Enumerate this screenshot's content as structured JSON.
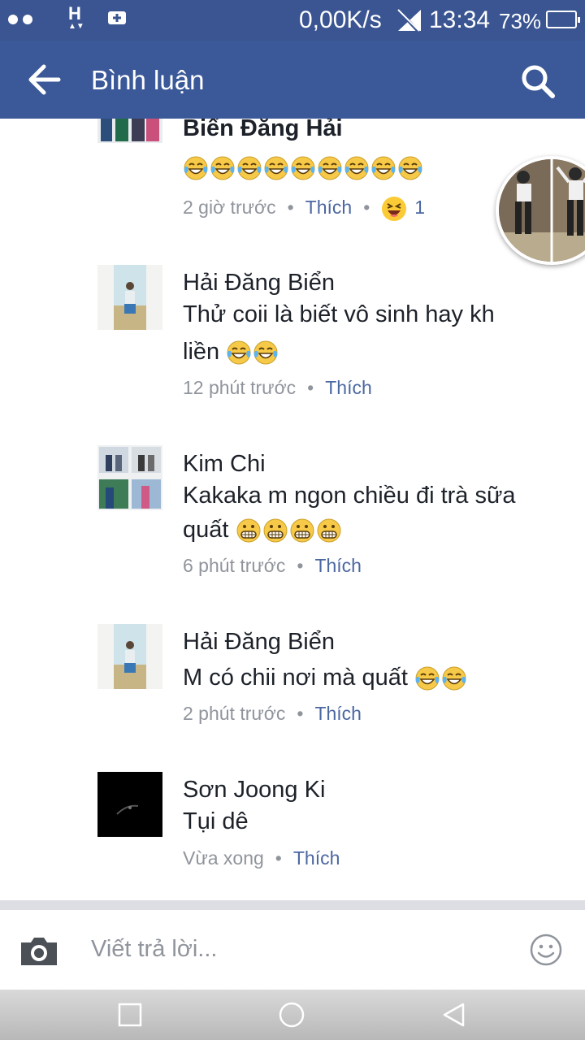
{
  "status_bar": {
    "net_speed": "0,00K/s",
    "time": "13:34",
    "battery": "73%",
    "network_letter": "H"
  },
  "header": {
    "title": "Bình luận",
    "back_icon": "arrow-left-icon",
    "search_icon": "search-icon"
  },
  "comments": [
    {
      "author": "Biển Đăng Hải",
      "emoji_count": 9,
      "emoji": "tears-of-joy",
      "time": "2 giờ trước",
      "like": "Thích",
      "reaction": "laughing",
      "reaction_count": "1"
    },
    {
      "author": "Hải Đăng Biển",
      "text_line1": "Thử coii là biết vô sinh hay kh",
      "text_line2": "liền",
      "emoji": "tears-of-joy",
      "emoji_count": 2,
      "time": "12 phút trước",
      "like": "Thích"
    },
    {
      "author": "Kim Chi",
      "text_line1": "Kakaka m ngon chiều đi trà sữa",
      "text_line2": "quất",
      "emoji": "grinning",
      "emoji_count": 4,
      "time": "6 phút trước",
      "like": "Thích"
    },
    {
      "author": "Hải Đăng Biển",
      "text_line1": "M có chii nơi mà quất",
      "emoji": "tears-of-joy",
      "emoji_count": 2,
      "time": "2 phút trước",
      "like": "Thích"
    },
    {
      "author": "Sơn Joong Ki",
      "text_line1": "Tụi dê",
      "time": "Vừa xong",
      "like": "Thích"
    }
  ],
  "composer": {
    "placeholder": "Viết trả lời...",
    "camera_icon": "camera-icon",
    "emoji_icon": "smiley-icon"
  },
  "nav_bar": {
    "buttons": [
      "recent-apps-icon",
      "home-icon",
      "back-triangle-icon"
    ]
  },
  "colors": {
    "brand": "#3b5998",
    "status_bar": "#3a5591",
    "like_link": "#4b67a1",
    "meta": "#90949c"
  }
}
